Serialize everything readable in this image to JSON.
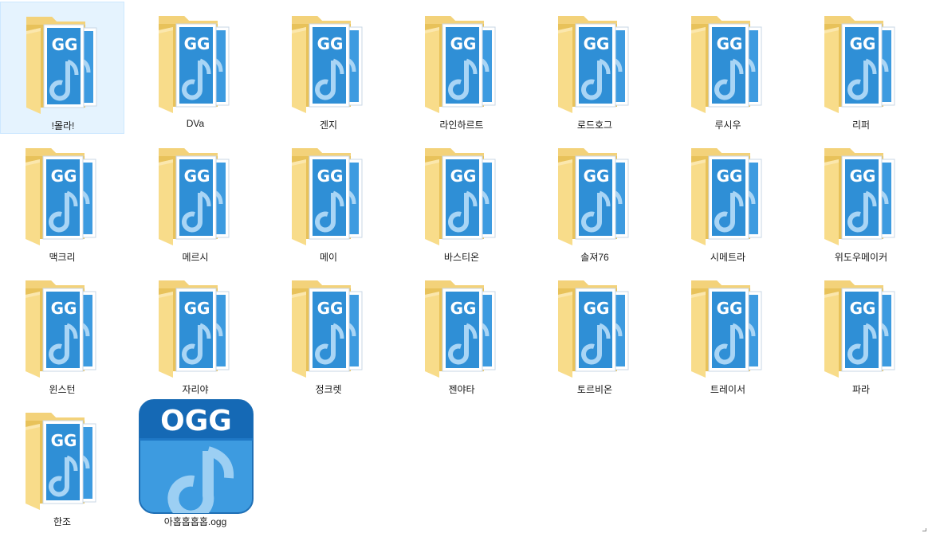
{
  "folders": [
    {
      "label": "!몰라!",
      "selected": true
    },
    {
      "label": "DVa"
    },
    {
      "label": "겐지"
    },
    {
      "label": "라인하르트"
    },
    {
      "label": "로드호그"
    },
    {
      "label": "루시우"
    },
    {
      "label": "리퍼"
    },
    {
      "label": "맥크리"
    },
    {
      "label": "메르시"
    },
    {
      "label": "메이"
    },
    {
      "label": "바스티온"
    },
    {
      "label": "솔져76"
    },
    {
      "label": "시메트라"
    },
    {
      "label": "위도우메이커"
    },
    {
      "label": "윈스턴"
    },
    {
      "label": "자리야"
    },
    {
      "label": "정크렛"
    },
    {
      "label": "젠야타"
    },
    {
      "label": "토르비온"
    },
    {
      "label": "트레이서"
    },
    {
      "label": "파라"
    },
    {
      "label": "한조"
    }
  ],
  "file": {
    "label": "아홉홉홉홉.ogg",
    "icon_text": "OGG",
    "icon": "ogg-file-icon"
  },
  "colors": {
    "folder_back": "#e8c25a",
    "folder_front": "#f8dc8a",
    "ogg_blue": "#2f8fd6",
    "ogg_blue_dark": "#1569b5",
    "selection": "#e5f3fe"
  }
}
